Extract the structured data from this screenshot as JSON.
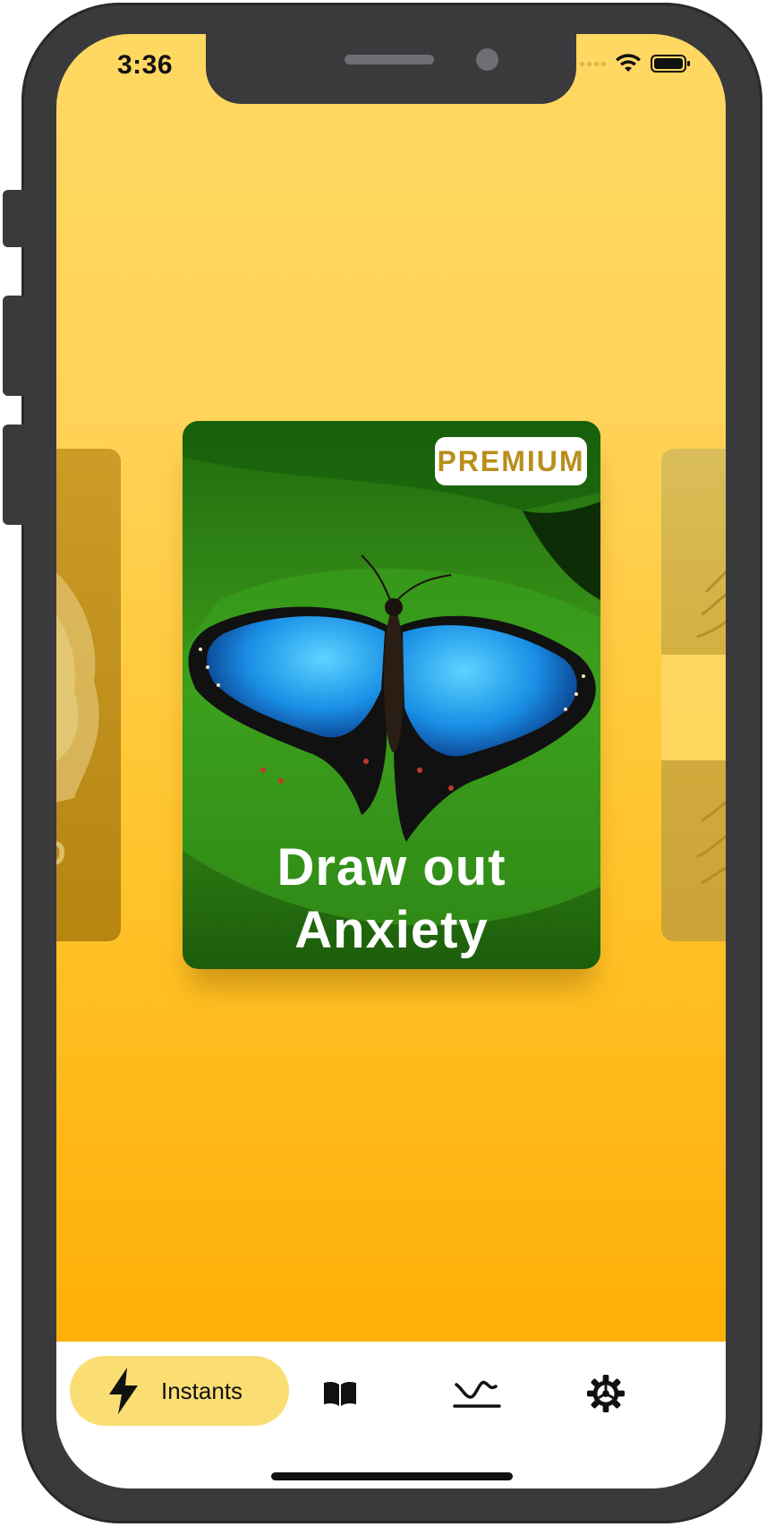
{
  "status_bar": {
    "time": "3:36"
  },
  "carousel": {
    "main_card": {
      "badge": "PREMIUM",
      "title_line1": "Draw out",
      "title_line2": "Anxiety"
    },
    "left_card_partial_text": "D"
  },
  "tabbar": {
    "instants_label": "Instants",
    "tabs": [
      {
        "icon": "lightning-icon",
        "label": "Instants",
        "active": true
      },
      {
        "icon": "book-icon",
        "active": false
      },
      {
        "icon": "wave-signature-icon",
        "active": false
      },
      {
        "icon": "gear-icon",
        "active": false
      }
    ]
  },
  "colors": {
    "background_top": "#ffd862",
    "background_bottom": "#ffac00",
    "active_tab": "#fbde73",
    "premium_text": "#b98e1b"
  }
}
